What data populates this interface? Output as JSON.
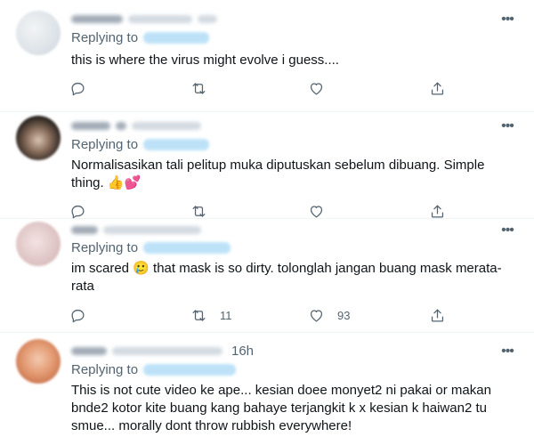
{
  "tweets": [
    {
      "replying_label": "Replying to",
      "text": "this is where the virus might evolve i guess....",
      "time": "",
      "retweets": "",
      "likes": ""
    },
    {
      "replying_label": "Replying to",
      "text": "Normalisasikan tali pelitup muka diputuskan sebelum dibuang. Simple thing. 👍💕",
      "time": "",
      "retweets": "",
      "likes": ""
    },
    {
      "replying_label": "Replying to",
      "text": "im scared 🥲 that mask is so dirty. tolonglah jangan buang mask merata-rata",
      "time": "",
      "retweets": "11",
      "likes": "93"
    },
    {
      "replying_label": "Replying to",
      "text": "This is not cute video ke ape... kesian doee monyet2 ni pakai or makan bnde2 kotor kite buang kang bahaye terjangkit k x kesian k haiwan2 tu smue... morally dont throw rubbish everywhere!",
      "time": "16h",
      "retweets": "",
      "likes": ""
    }
  ],
  "icons": {
    "more": "more-dots-icon",
    "reply": "reply-bubble-icon",
    "retweet": "retweet-arrows-icon",
    "like": "heart-icon",
    "share": "share-upload-icon"
  },
  "colors": {
    "secondary_text": "#536471",
    "handle_link_blur": "#bde2f8",
    "divider": "#eff3f4"
  }
}
